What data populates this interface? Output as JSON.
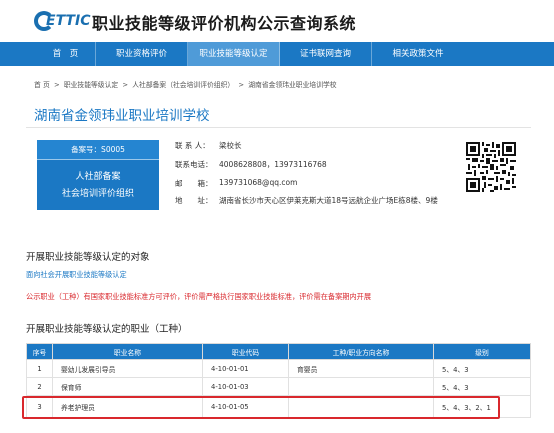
{
  "header": {
    "logo_text": "ETTIC",
    "site_title": "职业技能等级评价机构公示查询系统"
  },
  "nav": {
    "items": [
      {
        "label": "首　页",
        "active": false
      },
      {
        "label": "职业资格评价",
        "active": false
      },
      {
        "label": "职业技能等级认定",
        "active": true
      },
      {
        "label": "证书联网查询",
        "active": false
      },
      {
        "label": "相关政策文件",
        "active": false
      }
    ]
  },
  "breadcrumb": {
    "home": "首 页",
    "sep1": ">",
    "level1": "职业技能等级认定",
    "sep2": ">",
    "level2": "人社部备案（社会培训评价组织）",
    "sep3": ">",
    "level3": "湖南省金领玮业职业培训学校"
  },
  "org": {
    "title": "湖南省金领玮业职业培训学校",
    "record_no": "备案号：S0005",
    "badge_line1": "人社部备案",
    "badge_line2": "社会培训评价组织",
    "contact_label": "联 系 人：",
    "contact_value": "梁校长",
    "phone_label": "联系电话：",
    "phone_value": "4008628808，13973116768",
    "email_label": "邮　　箱：",
    "email_value": "139731068@qq.com",
    "address_label": "地　　址：",
    "address_value": "湖南省长沙市天心区伊莱克斯大道18号远航企业广场E栋8楼、9楼"
  },
  "targets": {
    "title": "开展职业技能等级认定的对象",
    "text": "面向社会开展职业技能等级认定",
    "notice": "公示职业（工种）有国家职业技能标准方可评价，评价需严格执行国家职业技能标准，评价需在备案期内开展"
  },
  "occupations": {
    "title": "开展职业技能等级认定的职业（工种）",
    "columns": [
      "序号",
      "职业名称",
      "职业代码",
      "工种/职业方向名称",
      "级别"
    ],
    "rows": [
      [
        "1",
        "婴幼儿发展引导员",
        "4-10-01-01",
        "育婴员",
        "5、4、3"
      ],
      [
        "2",
        "保育师",
        "4-10-01-03",
        "",
        "5、4、3"
      ],
      [
        "3",
        "养老护理员",
        "4-10-01-05",
        "",
        "5、4、3、2、1"
      ]
    ]
  },
  "colors": {
    "primary": "#1b78c4",
    "nav_active": "#4f9bd8",
    "notice_red": "#d9282d",
    "link_blue": "#1b78c4"
  }
}
